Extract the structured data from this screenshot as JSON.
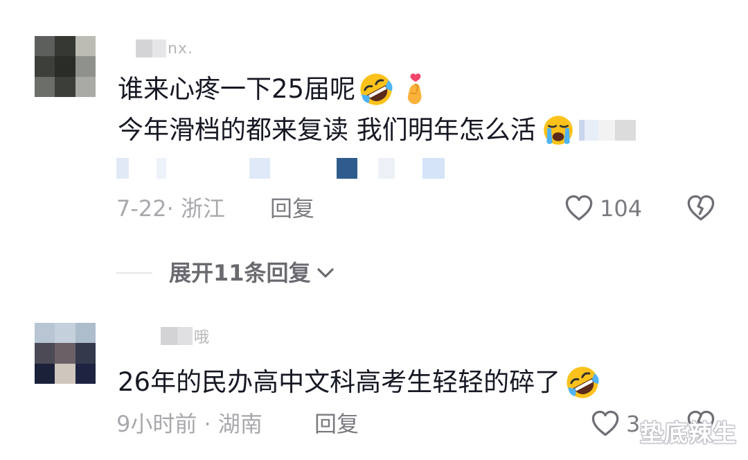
{
  "comments": [
    {
      "username_tail": "nx.",
      "lines": [
        "谁来心疼一下25届呢",
        "今年滑档的都来复读 我们明年怎么活"
      ],
      "meta": "7-22· 浙江",
      "reply_label": "回复",
      "likes": "104"
    },
    {
      "username_tail": "哦",
      "lines": [
        "26年的民办高中文科高考生轻轻的碎了"
      ],
      "meta": "9小时前 · 湖南",
      "reply_label": "回复",
      "likes": "3"
    }
  ],
  "expand_replies": "展开11条回复",
  "watermark": "垫底辣生",
  "icons": {
    "laugh": "rolling-on-floor-laughing-emoji",
    "finger_heart": "finger-heart-emoji",
    "cry": "loudly-crying-emoji",
    "like": "heart-outline-icon",
    "dislike": "broken-heart-icon",
    "expand": "chevron-down-icon"
  },
  "colors": {
    "text": "#161823",
    "meta": "#a8a8ad",
    "action": "#7a7a80"
  }
}
